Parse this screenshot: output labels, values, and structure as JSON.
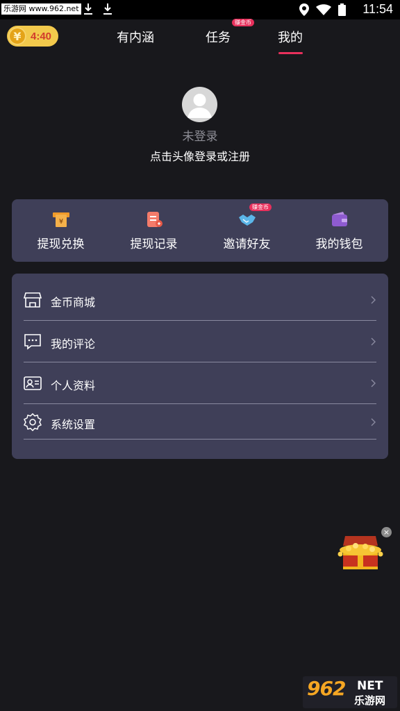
{
  "status_bar": {
    "watermark": "乐游网 www.962.net",
    "time": "11:54",
    "icons": [
      "download-icon",
      "download-icon",
      "location-icon",
      "wifi-icon",
      "battery-icon"
    ]
  },
  "header": {
    "coin_symbol": "¥",
    "coin_timer": "4:40",
    "tabs": [
      {
        "label": "有内涵",
        "active": false
      },
      {
        "label": "任务",
        "active": false,
        "badge": "赚金币"
      },
      {
        "label": "我的",
        "active": true
      }
    ],
    "accent_color": "#e8305c"
  },
  "profile": {
    "status": "未登录",
    "hint": "点击头像登录或注册"
  },
  "quick_actions": [
    {
      "label": "提现兑换",
      "icon": "withdraw-icon"
    },
    {
      "label": "提现记录",
      "icon": "record-icon"
    },
    {
      "label": "邀请好友",
      "icon": "handshake-icon",
      "badge": "赚金币"
    },
    {
      "label": "我的钱包",
      "icon": "wallet-icon"
    }
  ],
  "menu": [
    {
      "label": "金币商城",
      "icon": "store-icon"
    },
    {
      "label": "我的评论",
      "icon": "comment-icon"
    },
    {
      "label": "个人资料",
      "icon": "profile-card-icon"
    },
    {
      "label": "系统设置",
      "icon": "gear-icon"
    }
  ],
  "float_widget": {
    "icon": "treasure-chest-icon"
  },
  "watermark": {
    "big": "962",
    "net": "NET",
    "cn": "乐游网"
  }
}
